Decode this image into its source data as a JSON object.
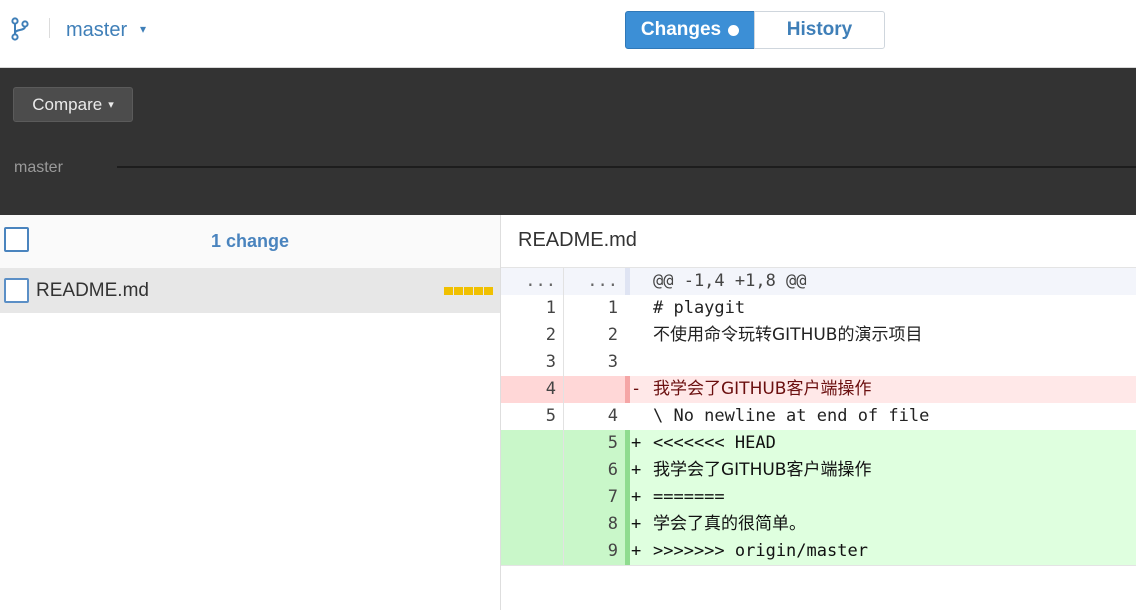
{
  "topbar": {
    "branch_name": "master",
    "branch_caret": "▾",
    "tabs": {
      "changes_label": "Changes",
      "history_label": "History"
    }
  },
  "compare": {
    "button_label": "Compare",
    "button_caret": "▾",
    "branch_label": "master"
  },
  "changes": {
    "count_label": "1 change",
    "files": [
      {
        "name": "README.md"
      }
    ]
  },
  "diff": {
    "file_title": "README.md",
    "lines": [
      {
        "type": "hunk",
        "old": "...",
        "new": "...",
        "sign": "",
        "text": "@@ -1,4 +1,8 @@"
      },
      {
        "type": "ctx",
        "old": "1",
        "new": "1",
        "sign": "",
        "text": "# playgit"
      },
      {
        "type": "ctx",
        "old": "2",
        "new": "2",
        "sign": "",
        "text": "不使用命令玩转GITHUB的演示项目"
      },
      {
        "type": "ctx",
        "old": "3",
        "new": "3",
        "sign": "",
        "text": ""
      },
      {
        "type": "del",
        "old": "4",
        "new": "",
        "sign": "-",
        "text": "我学会了GITHUB客户端操作"
      },
      {
        "type": "ctx",
        "old": "5",
        "new": "4",
        "sign": "",
        "text": "\\ No newline at end of file"
      },
      {
        "type": "add",
        "old": "",
        "new": "5",
        "sign": "+",
        "text": "<<<<<<< HEAD"
      },
      {
        "type": "add",
        "old": "",
        "new": "6",
        "sign": "+",
        "text": "我学会了GITHUB客户端操作"
      },
      {
        "type": "add",
        "old": "",
        "new": "7",
        "sign": "+",
        "text": "======="
      },
      {
        "type": "add",
        "old": "",
        "new": "8",
        "sign": "+",
        "text": "学会了真的很简单。"
      },
      {
        "type": "add",
        "old": "",
        "new": "9",
        "sign": "+",
        "text": ">>>>>>> origin/master"
      }
    ]
  },
  "colors": {
    "accent": "#3c8fd6",
    "link": "#3f7fb8",
    "band": "#333333",
    "added_bg": "#dfffdf",
    "deleted_bg": "#ffe8e8",
    "diffstat": "#f0c000"
  }
}
